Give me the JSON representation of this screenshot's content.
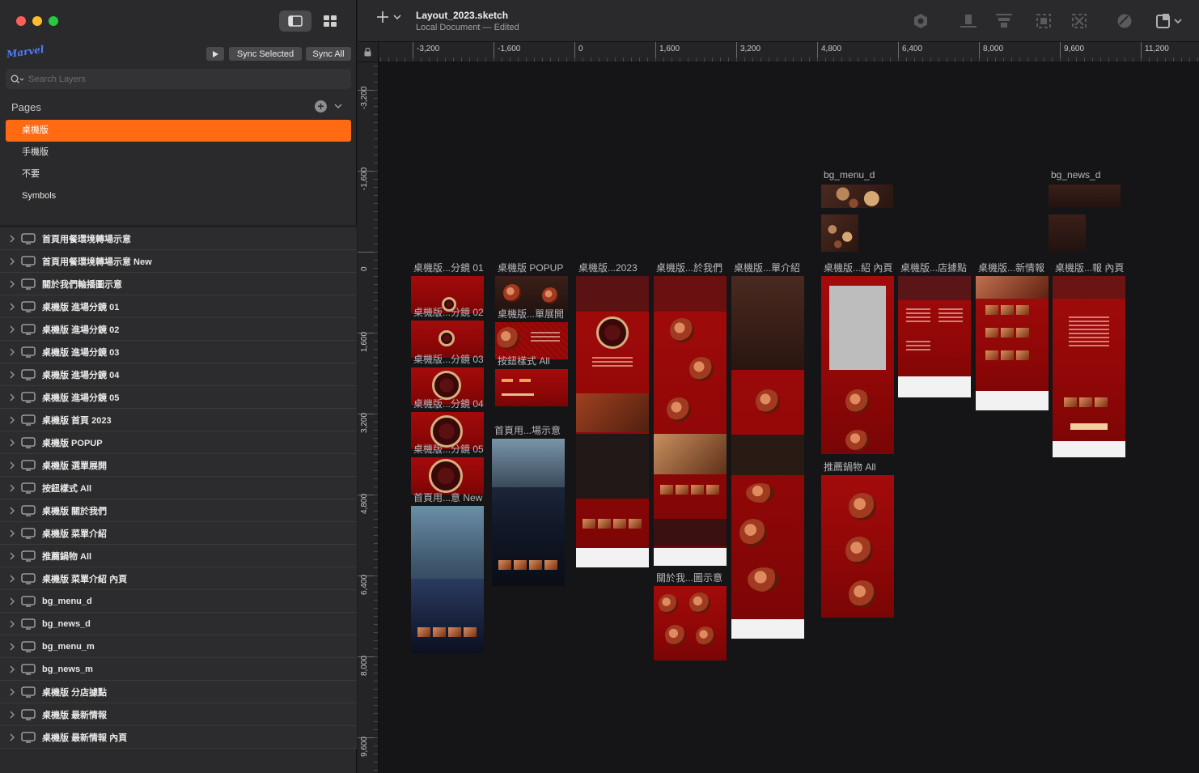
{
  "window": {
    "doc_title": "Layout_2023.sketch",
    "doc_subtitle": "Local Document — Edited"
  },
  "sidebar": {
    "logo": "Marvel",
    "sync_selected": "Sync Selected",
    "sync_all": "Sync All",
    "search_placeholder": "Search Layers",
    "pages_label": "Pages",
    "pages": [
      "桌機版",
      "手機版",
      "不要",
      "Symbols"
    ],
    "layers": [
      "首頁用餐環境轉場示意",
      "首頁用餐環境轉場示意 New",
      "關於我們輪播圖示意",
      "桌機版  進場分鏡 01",
      "桌機版  進場分鏡 02",
      "桌機版  進場分鏡 03",
      "桌機版  進場分鏡 04",
      "桌機版  進場分鏡 05",
      "桌機版  首頁 2023",
      "桌機版  POPUP",
      "桌機版  選單展開",
      "按鈕樣式 All",
      "桌機版  關於我們",
      "桌機版  菜單介紹",
      "推薦鍋物 All",
      "桌機版  菜單介紹 內頁",
      "bg_menu_d",
      "bg_news_d",
      "bg_menu_m",
      "bg_news_m",
      "桌機版  分店據點",
      "桌機版  最新情報",
      "桌機版  最新情報 內頁"
    ]
  },
  "rulers": {
    "horizontal": [
      "-3,200",
      "-1,600",
      "0",
      "1,600",
      "3,200",
      "4,800",
      "6,400",
      "8,000",
      "9,600",
      "11,200"
    ],
    "vertical": [
      "-3,200",
      "-1,600",
      "0",
      "1,600",
      "3,200",
      "4,800",
      "6,400",
      "8,000",
      "9,600"
    ]
  },
  "canvas": {
    "labels": {
      "bg_menu_d": "bg_menu_d",
      "bg_news_d": "bg_news_d",
      "scene01": "桌機版...分鏡 01",
      "scene02": "桌機版...分鏡 02",
      "scene03": "桌機版...分鏡 03",
      "scene04": "桌機版...分鏡 04",
      "scene05": "桌機版...分鏡 05",
      "transition_new": "首頁用...意 New",
      "popup": "桌機版  POPUP",
      "menu_open": "桌機版...單展開",
      "buttons_all": "按鈕樣式 All",
      "transition": "首頁用...場示意",
      "home2023": "桌機版...2023",
      "about": "桌機版...於我們",
      "about_carousel": "關於我...圖示意",
      "menu_intro": "桌機版...單介紹",
      "menu_detail": "桌機版...紹 內頁",
      "hotpot_all": "推薦鍋物 All",
      "stores": "桌機版...店據點",
      "news": "桌機版...新情報",
      "news_detail": "桌機版...報 內頁"
    }
  }
}
